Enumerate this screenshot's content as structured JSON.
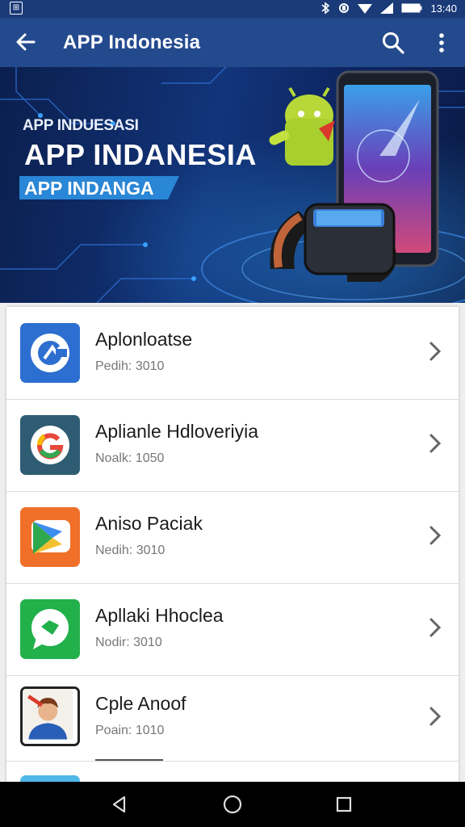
{
  "status_bar": {
    "time": "13:40"
  },
  "header": {
    "title": "APP Indonesia"
  },
  "banner": {
    "line1": "APP INDUESASI",
    "line2": "APP INDANESIA",
    "line3": "APP INDANGA"
  },
  "apps": [
    {
      "name": "Aplonloatse",
      "subtitle": "Pedih: 3010"
    },
    {
      "name": "Aplianle Hdloveriyia",
      "subtitle": "Noalk: 1050"
    },
    {
      "name": "Aniso Paciak",
      "subtitle": "Nedih: 3010"
    },
    {
      "name": "Apllaki Hhoclea",
      "subtitle": "Nodir: 3010"
    },
    {
      "name": "Cple Anoof",
      "subtitle": "Poain: 1010"
    }
  ],
  "colors": {
    "app_bar": "#244a8e",
    "status_bar": "#1a3a78",
    "banner_accent": "#2a86d6"
  }
}
